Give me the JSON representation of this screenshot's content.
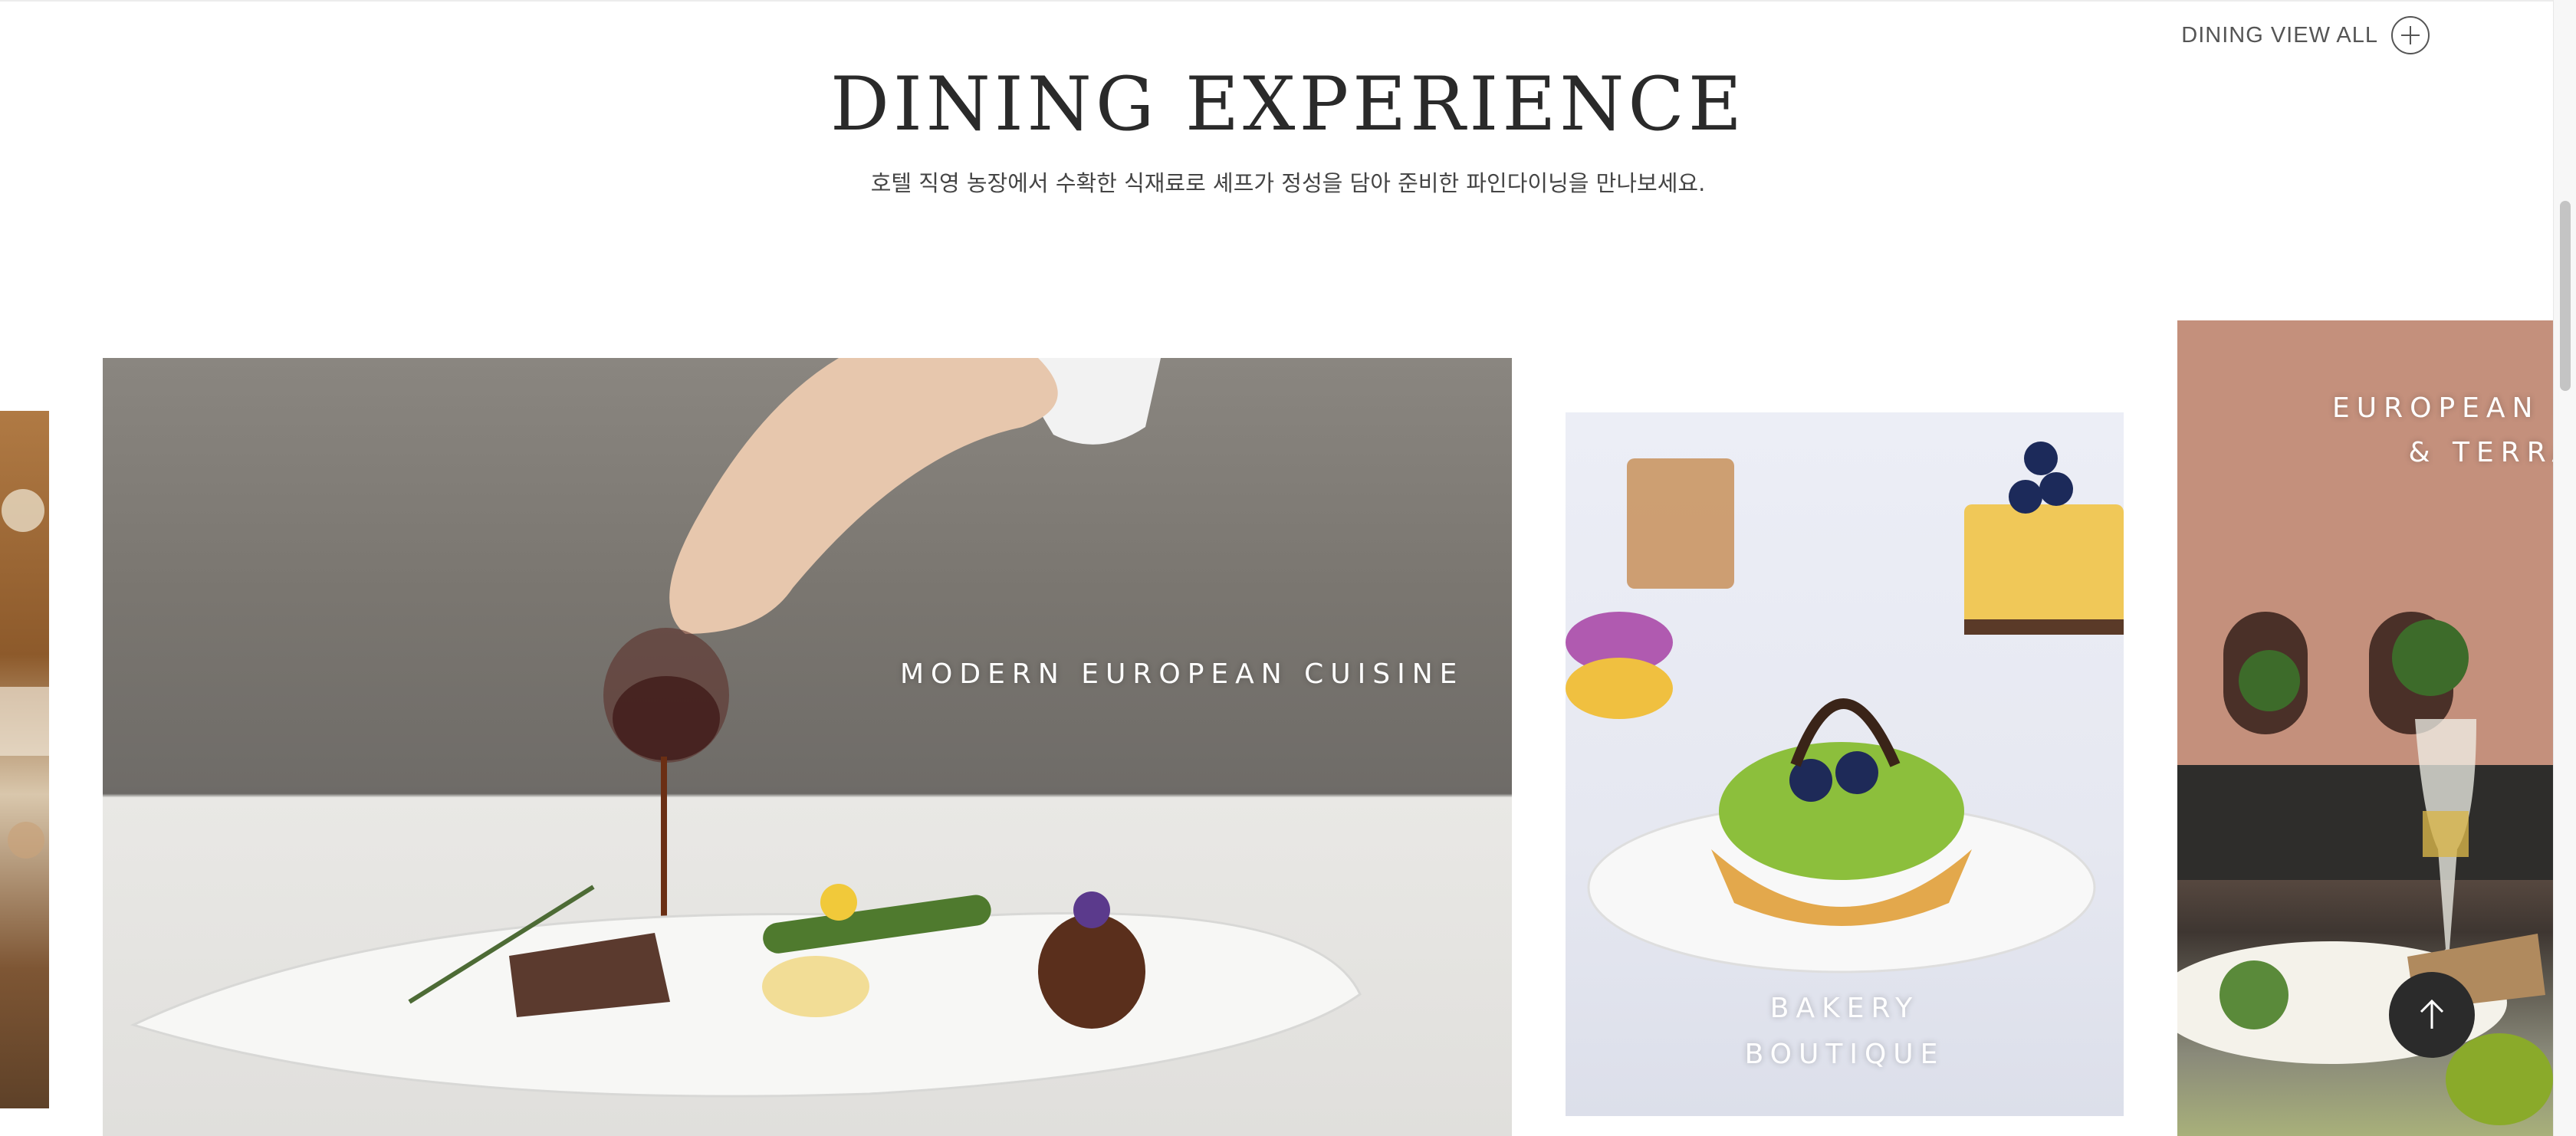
{
  "header": {
    "view_all_label": "DINING VIEW ALL",
    "title": "DINING EXPERIENCE",
    "subtitle": "호텔 직영 농장에서 수확한 식재료로 셰프가 정성을 담아 준비한 파인다이닝을 만나보세요."
  },
  "cards": [
    {
      "label": "",
      "image": "dining-dish-photo"
    },
    {
      "label": "MODERN EUROPEAN CUISINE",
      "image": "sauce-pouring-steak-plate-photo"
    },
    {
      "label_line1": "BAKERY",
      "label_line2": "BOUTIQUE",
      "image": "fruit-tart-pastries-photo"
    },
    {
      "label_line1": "EUROPEAN L",
      "label_line2": "& TERRA",
      "image": "terrace-wine-sandwich-photo"
    }
  ],
  "icons": {
    "view_all": "plus-circle-icon",
    "to_top": "arrow-up-icon"
  },
  "colors": {
    "title": "#2a2a2a",
    "to_top_bg": "#2b2b2b"
  }
}
